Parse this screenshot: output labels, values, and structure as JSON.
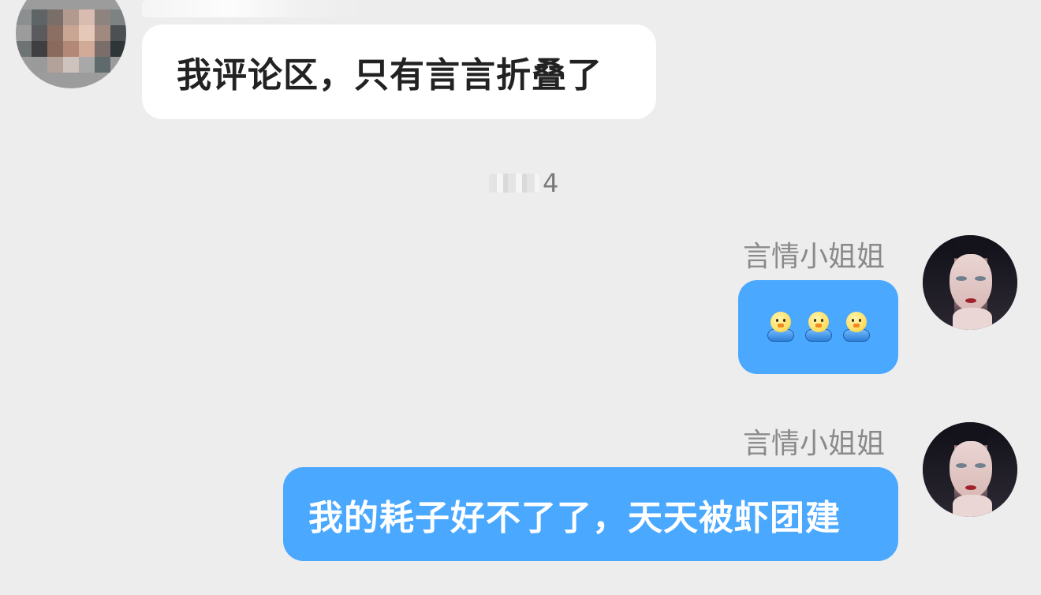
{
  "messages": [
    {
      "direction": "incoming",
      "sender": "",
      "text": "我评论区，只有言言折叠了",
      "avatar": "pixelated-avatar",
      "bubble_color": "#ffffff",
      "text_color": "#222222"
    },
    {
      "direction": "outgoing",
      "sender": "言情小姐姐",
      "text": "",
      "emojis": [
        "chick-emoji",
        "chick-emoji",
        "chick-emoji"
      ],
      "avatar": "girl-avatar",
      "bubble_color": "#4aa8ff"
    },
    {
      "direction": "outgoing",
      "sender": "言情小姐姐",
      "text": "我的耗子好不了了，天天被虾团建",
      "avatar": "girl-avatar",
      "bubble_color": "#4aa8ff",
      "text_color": "#ffffff"
    }
  ],
  "time_separator": {
    "visible_text": "4"
  },
  "colors": {
    "background": "#ededed",
    "outgoing_bubble": "#4aa8ff",
    "incoming_bubble": "#ffffff",
    "sender_name": "#8a8a8a"
  }
}
